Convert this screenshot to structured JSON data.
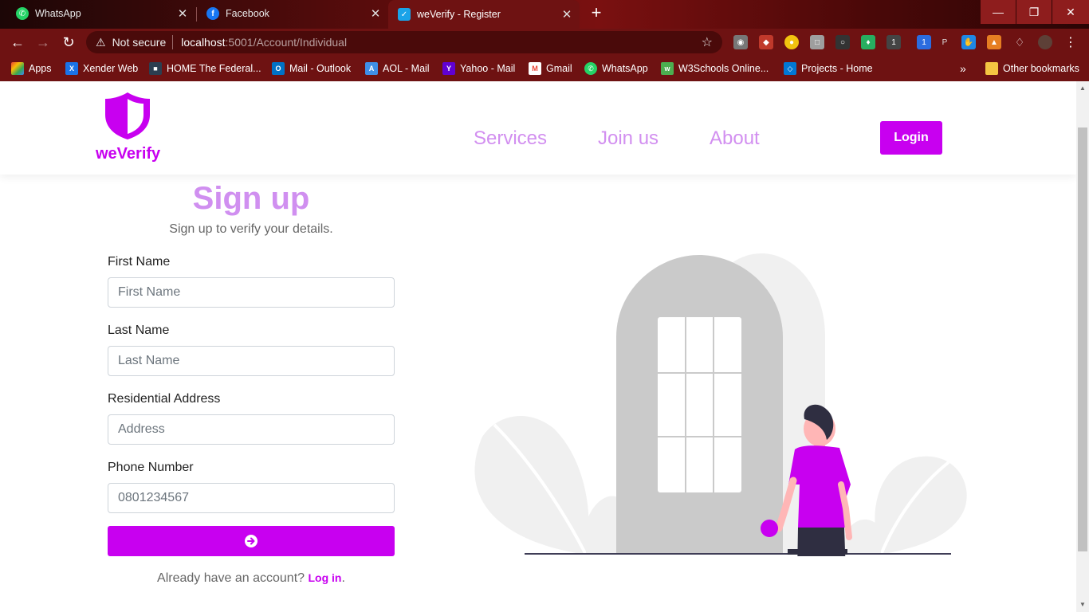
{
  "browser": {
    "tabs": [
      {
        "title": "WhatsApp",
        "icon": "whatsapp-icon",
        "color": "#25d366",
        "active": false
      },
      {
        "title": "Facebook",
        "icon": "facebook-icon",
        "color": "#1877f2",
        "active": false
      },
      {
        "title": "weVerify - Register",
        "icon": "weverify-icon",
        "color": "#1aa3e8",
        "active": true
      }
    ],
    "address": {
      "security_label": "Not secure",
      "host": "localhost",
      "path": ":5001/Account/Individual"
    },
    "bookmarks": [
      {
        "label": "Apps",
        "icon": "apps-grid-icon"
      },
      {
        "label": "Xender Web",
        "icon": "xender-icon"
      },
      {
        "label": "HOME  The Federal...",
        "icon": "federal-icon"
      },
      {
        "label": "Mail - Outlook",
        "icon": "outlook-icon"
      },
      {
        "label": "AOL - Mail",
        "icon": "aol-icon"
      },
      {
        "label": "Yahoo - Mail",
        "icon": "yahoo-icon"
      },
      {
        "label": "Gmail",
        "icon": "gmail-icon"
      },
      {
        "label": "WhatsApp",
        "icon": "whatsapp-icon"
      },
      {
        "label": "W3Schools Online...",
        "icon": "w3schools-icon"
      },
      {
        "label": "Projects - Home",
        "icon": "projects-icon"
      }
    ],
    "overflow_label": "»",
    "other_bookmarks": "Other bookmarks"
  },
  "site": {
    "brand": "weVerify",
    "nav": [
      "Services",
      "Join us",
      "About"
    ],
    "login_label": "Login",
    "accent_color": "#c800f0"
  },
  "form": {
    "title": "Sign up",
    "subtitle": "Sign up to verify your details.",
    "fields": [
      {
        "label": "First Name",
        "placeholder": "First Name"
      },
      {
        "label": "Last Name",
        "placeholder": "Last Name"
      },
      {
        "label": "Residential Address",
        "placeholder": "Address"
      },
      {
        "label": "Phone Number",
        "placeholder": "0801234567"
      }
    ],
    "submit_icon": "arrow-circle-right-icon",
    "already_text": "Already have an account?",
    "login_link": "Log in",
    "login_suffix": "."
  }
}
